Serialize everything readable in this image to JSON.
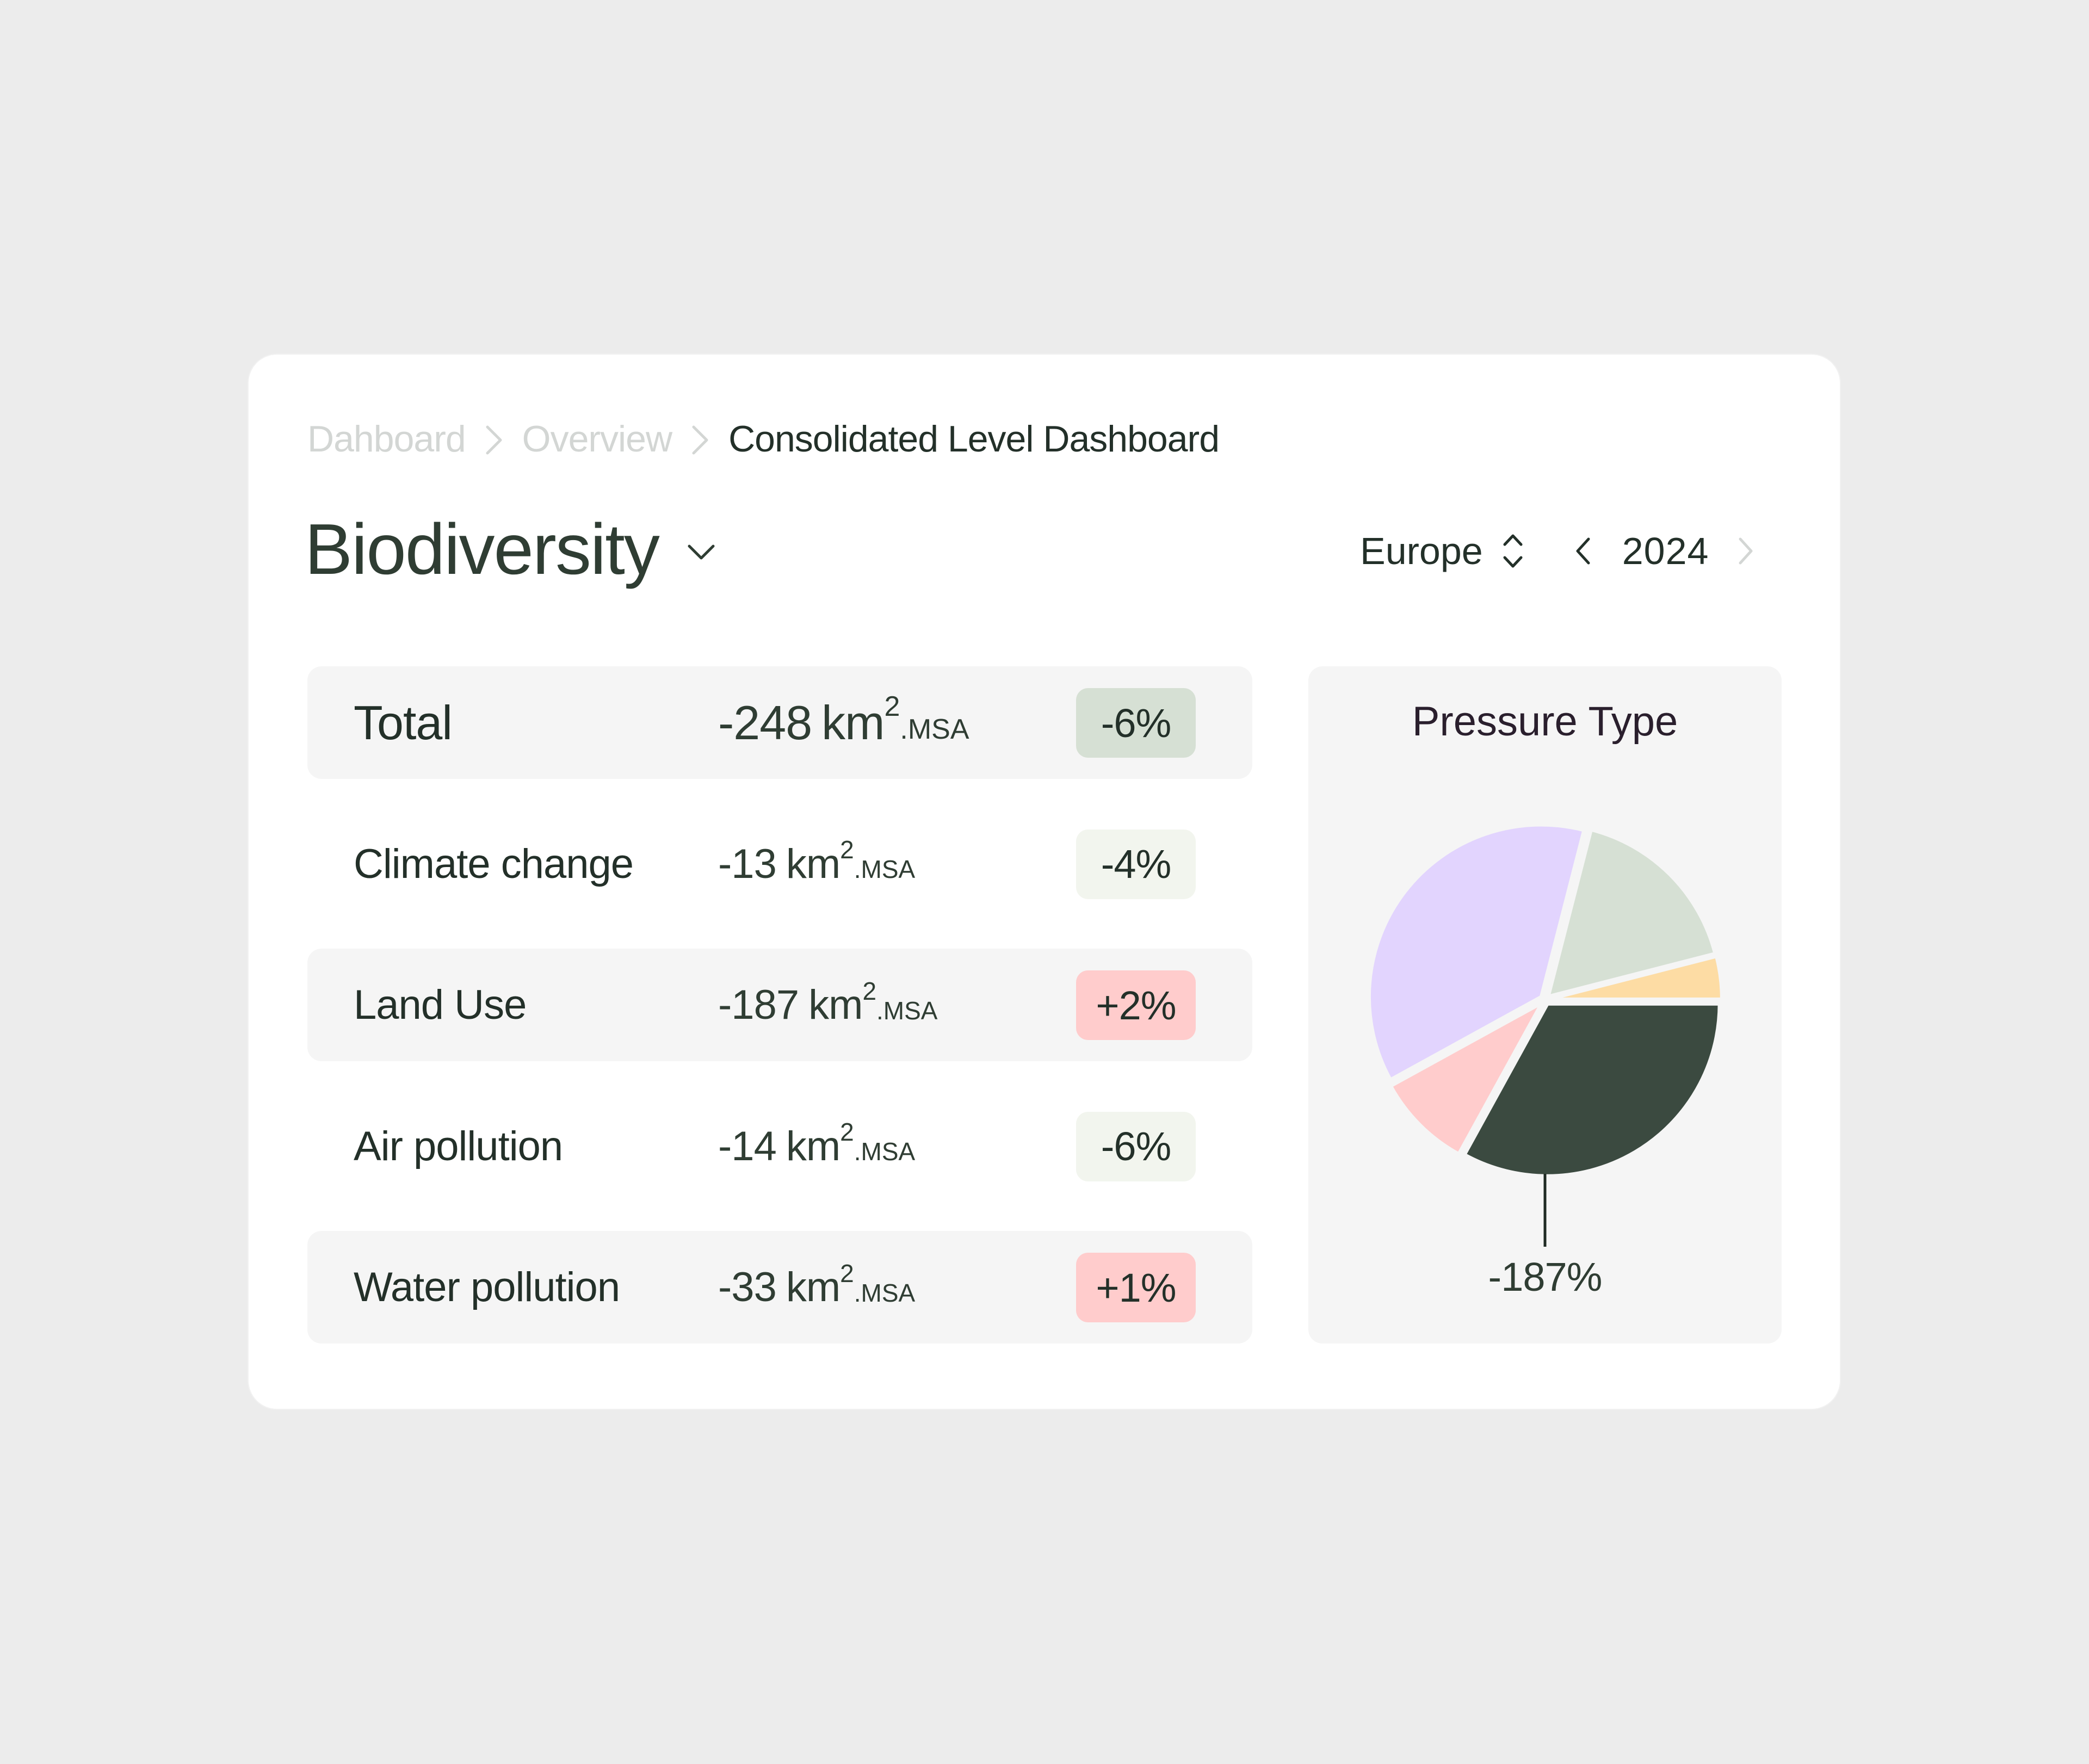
{
  "breadcrumb": {
    "items": [
      "Dahboard",
      "Overview",
      "Consolidated Level Dashboard"
    ],
    "separator_icon": "chevron-right-icon"
  },
  "header": {
    "title": "Biodiversity",
    "title_dropdown_icon": "chevron-down-icon",
    "region": "Europe",
    "region_icon": "up-down-chevron-icon",
    "year": "2024",
    "prev_year_icon": "chevron-left-icon",
    "next_year_icon": "chevron-right-icon",
    "next_year_enabled": false
  },
  "metrics": {
    "unit": "km",
    "unit_sup": "2",
    "unit_suffix": ".MSA",
    "rows": [
      {
        "label": "Total",
        "value": "-248",
        "change": "-6%",
        "badge_color": "#d6e0d4",
        "shaded": true,
        "total": true
      },
      {
        "label": "Climate change",
        "value": "-13",
        "change": "-4%",
        "badge_color": "#f2f5ee",
        "shaded": false
      },
      {
        "label": "Land Use",
        "value": "-187",
        "change": "+2%",
        "badge_color": "#ffcccc",
        "shaded": true
      },
      {
        "label": "Air pollution",
        "value": "-14",
        "change": "-6%",
        "badge_color": "#f2f5ee",
        "shaded": false
      },
      {
        "label": "Water pollution",
        "value": "-33",
        "change": "+1%",
        "badge_color": "#ffcccc",
        "shaded": true
      }
    ]
  },
  "colors": {
    "background": "#ececec",
    "card": "#ffffff",
    "text_primary": "#2f3d33",
    "breadcrumb_inactive": "#d3d6d4",
    "panel": "#f5f5f5"
  },
  "chart_data": {
    "type": "pie",
    "title": "Pressure Type",
    "start_angle_deg": 0,
    "direction": "clockwise",
    "slices": [
      {
        "name": "dark",
        "value": 33,
        "color": "#3b4a40"
      },
      {
        "name": "pink",
        "value": 9,
        "color": "#ffcccc"
      },
      {
        "name": "lavender",
        "value": 37,
        "color": "#e2d4fe"
      },
      {
        "name": "sage",
        "value": 17,
        "color": "#d6e0d4"
      },
      {
        "name": "yellow",
        "value": 4,
        "color": "#fddca4"
      }
    ],
    "annotation": {
      "slice": "dark",
      "text": "-187%"
    },
    "legend": "none"
  }
}
